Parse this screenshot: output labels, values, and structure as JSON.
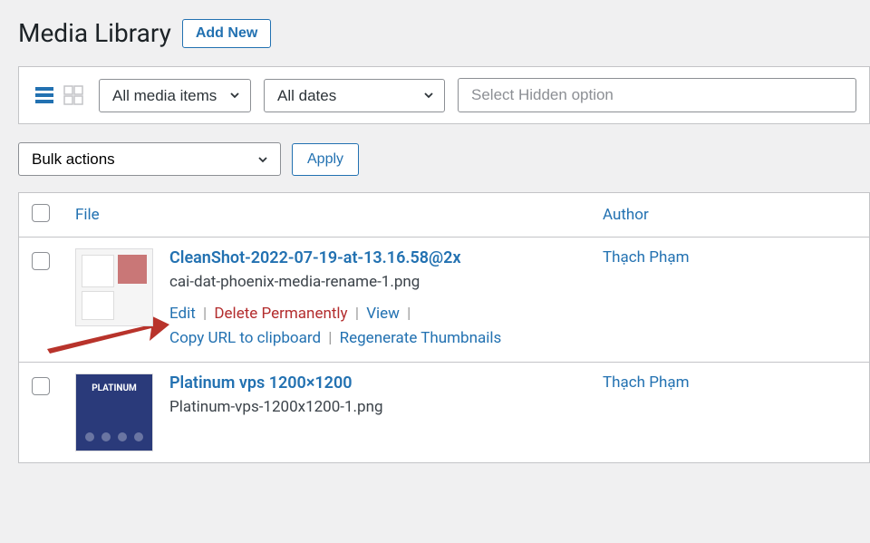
{
  "header": {
    "title": "Media Library",
    "add_new_label": "Add New"
  },
  "filters": {
    "media_filter": "All media items",
    "date_filter": "All dates",
    "hidden_placeholder": "Select Hidden option"
  },
  "bulk": {
    "selected": "Bulk actions",
    "apply_label": "Apply"
  },
  "table": {
    "columns": {
      "file": "File",
      "author": "Author"
    },
    "rows": [
      {
        "title": "CleanShot-2022-07-19-at-13.16.58@2x",
        "filename": "cai-dat-phoenix-media-rename-1.png",
        "author": "Thạch Phạm",
        "actions": {
          "edit": "Edit",
          "delete": "Delete Permanently",
          "view": "View",
          "copy_url": "Copy URL to clipboard",
          "regen": "Regenerate Thumbnails"
        },
        "show_actions": true,
        "thumb_style": "screenshot"
      },
      {
        "title": "Platinum vps 1200×1200",
        "filename": "Platinum-vps-1200x1200-1.png",
        "author": "Thạch Phạm",
        "show_actions": false,
        "thumb_style": "platinum",
        "thumb_label": "PLATINUM"
      }
    ]
  }
}
